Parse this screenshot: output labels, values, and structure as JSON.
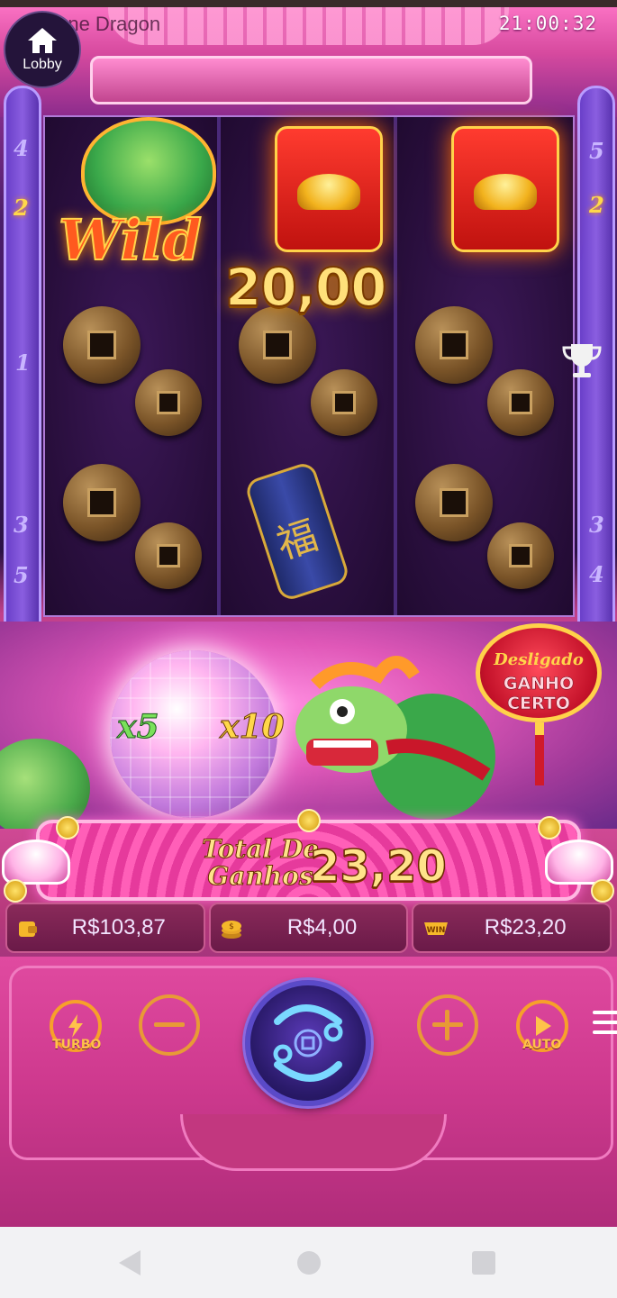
{
  "app": {
    "title": "Fortune Dragon",
    "clock": "21:00:32"
  },
  "lobby": {
    "label": "Lobby"
  },
  "paylines": {
    "left": [
      "4",
      "2",
      "1",
      "3",
      "5"
    ],
    "right": [
      "5",
      "2",
      "3",
      "4"
    ]
  },
  "reels": {
    "symbols": [
      [
        "wild",
        "coins",
        "coins"
      ],
      [
        "red-envelope",
        "coins",
        "firecracker"
      ],
      [
        "red-envelope",
        "coins",
        "coins"
      ]
    ],
    "wild_text": "Wild",
    "firecracker_char": "福",
    "win_amount": "20,00"
  },
  "bonus": {
    "multipliers": [
      "x5",
      "x10"
    ],
    "ganho_certo": {
      "status": "Desligado",
      "label": "GANHO CERTO"
    }
  },
  "total": {
    "label": "Total De Ganhos",
    "value": "23,20"
  },
  "stats": {
    "balance": "R$103,87",
    "bet": "R$4,00",
    "win": "R$23,20",
    "win_icon_text": "WIN"
  },
  "controls": {
    "turbo_label": "TURBO",
    "auto_label": "AUTO"
  },
  "colors": {
    "accent_gold": "#ffd84a",
    "panel_pink": "#e04aa0",
    "reel_bg": "#2a0f3f"
  }
}
